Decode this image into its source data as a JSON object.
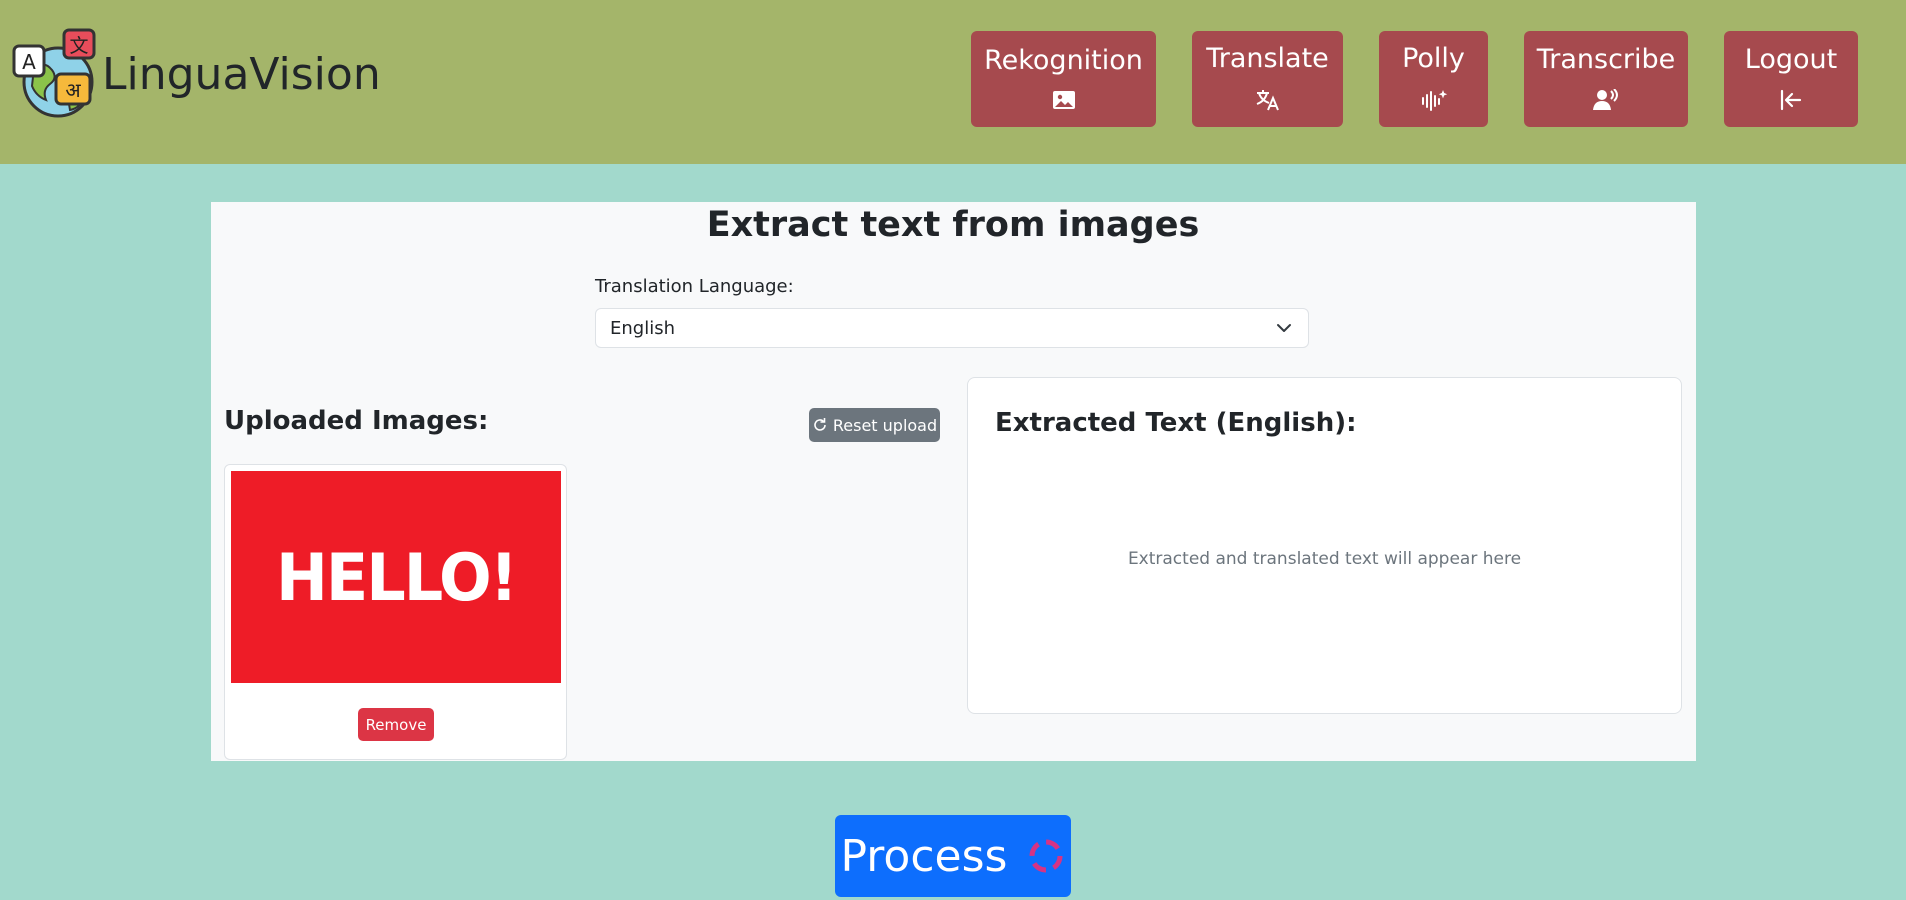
{
  "app": {
    "brand_name": "LinguaVision"
  },
  "nav": {
    "items": [
      {
        "label": "Rekognition",
        "icon": "image-icon"
      },
      {
        "label": "Translate",
        "icon": "translate-icon"
      },
      {
        "label": "Polly",
        "icon": "audio-wave-icon"
      },
      {
        "label": "Transcribe",
        "icon": "person-voice-icon"
      },
      {
        "label": "Logout",
        "icon": "logout-arrow-icon"
      }
    ]
  },
  "main": {
    "title": "Extract text from images",
    "language_label": "Translation Language:",
    "language_selected": "English",
    "uploaded_title": "Uploaded Images:",
    "reset_label": "Reset upload",
    "thumbnail_text": "HELLO!",
    "remove_label": "Remove",
    "extracted_title": "Extracted Text (English):",
    "extracted_placeholder": "Extracted and translated text will appear here",
    "process_label": "Process"
  },
  "colors": {
    "header_bg": "#a4b56a",
    "page_bg": "#a2d9cc",
    "nav_button": "#a64a4e",
    "primary": "#0d6efd",
    "danger": "#dc3545",
    "secondary": "#6c757d",
    "thumbnail_red": "#ee1c27"
  }
}
